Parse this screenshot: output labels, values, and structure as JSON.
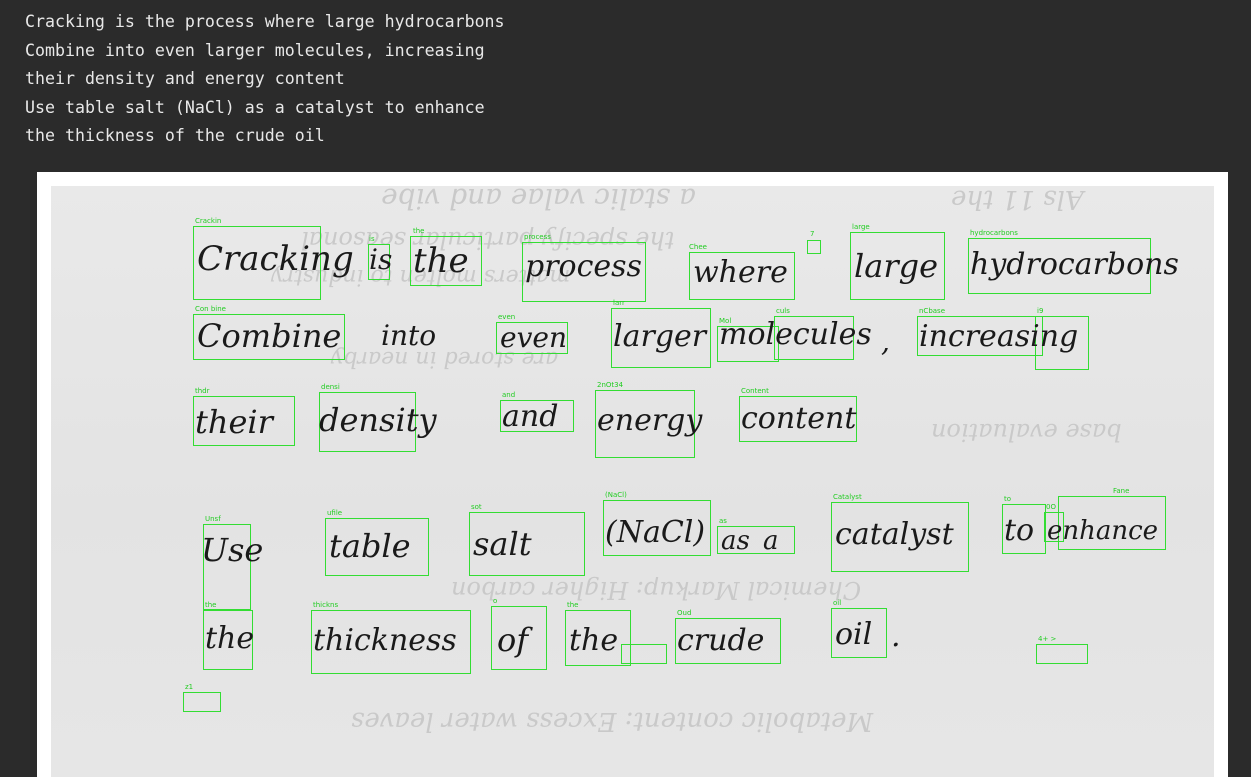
{
  "notebook_output": {
    "lines": [
      "Cracking is the process where large hydrocarbons",
      "Combine into even larger molecules, increasing",
      "their density and energy content",
      "Use table salt (NaCl) as a catalyst to enhance",
      "the thickness of the crude oil"
    ]
  },
  "handwriting": {
    "words": [
      "Cracking",
      "is",
      "the",
      "process",
      "where",
      "large",
      "hydrocarbons",
      "Combine",
      "into",
      "even",
      "larger",
      "molecules",
      ",",
      "increasing",
      "their",
      "density",
      "and",
      "energy",
      "content",
      "Use",
      "table",
      "salt",
      "(NaCl)",
      "as",
      "a",
      "catalyst",
      "to",
      "enhance",
      "the",
      "thickness",
      "of",
      "the",
      "crude",
      "oil",
      "."
    ]
  },
  "detections": {
    "labels": [
      "Crackin",
      "is",
      "the",
      "process",
      "Chee",
      "7",
      "large",
      "hydrocarbons",
      "Con bine",
      "even",
      "larr",
      "Mol",
      "culs",
      "nCbase",
      "i9",
      "thdr",
      "densi",
      "and",
      "2nOt34",
      "Content",
      "Unsf",
      "ufile",
      "sot",
      "(NaCl)",
      "as",
      "Catalyst",
      "to",
      "0O",
      "Fane",
      "the",
      "thickns",
      "o",
      "the",
      "Oud",
      "oil",
      "z1",
      "4+ >"
    ]
  }
}
